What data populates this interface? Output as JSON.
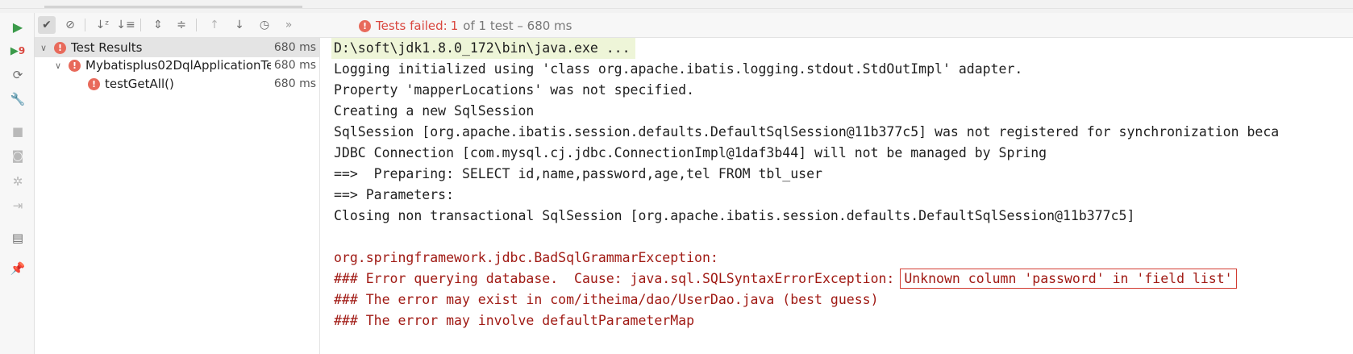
{
  "status": {
    "label": "Tests failed:",
    "failed_count": "1",
    "rest": "of 1 test – 680 ms"
  },
  "tree": {
    "root": {
      "label": "Test Results",
      "time": "680 ms"
    },
    "class_node": {
      "label": "Mybatisplus02DqlApplicationTe",
      "time": "680 ms"
    },
    "method_node": {
      "label": "testGetAll()",
      "time": "680 ms"
    }
  },
  "console": {
    "lines": [
      "D:\\soft\\jdk1.8.0_172\\bin\\java.exe ...",
      "Logging initialized using 'class org.apache.ibatis.logging.stdout.StdOutImpl' adapter.",
      "Property 'mapperLocations' was not specified.",
      "Creating a new SqlSession",
      "SqlSession [org.apache.ibatis.session.defaults.DefaultSqlSession@11b377c5] was not registered for synchronization beca",
      "JDBC Connection [com.mysql.cj.jdbc.ConnectionImpl@1daf3b44] will not be managed by Spring",
      "==>  Preparing: SELECT id,name,password,age,tel FROM tbl_user",
      "==> Parameters: ",
      "Closing non transactional SqlSession [org.apache.ibatis.session.defaults.DefaultSqlSession@11b377c5]",
      "org.springframework.jdbc.BadSqlGrammarException: ",
      "### Error querying database.  Cause: java.sql.SQLSyntaxErrorException: ",
      "Unknown column 'password' in 'field list'",
      "### The error may exist in com/itheima/dao/UserDao.java (best guess)",
      "### The error may involve defaultParameterMap"
    ]
  },
  "colors": {
    "error_red": "#d9473f",
    "console_error": "#a01a14",
    "run_green": "#3b9a4a",
    "highlight_box": "#d23c32"
  },
  "icons": {
    "run": "play-icon",
    "rerun_failed": "rerun-failed-icon",
    "show_passed": "check-icon",
    "show_ignored": "ignored-icon",
    "sort_alpha": "sort-alpha-icon",
    "sort_duration": "sort-duration-icon",
    "expand_all": "expand-all-icon",
    "collapse_all": "collapse-all-icon",
    "prev_failed": "arrow-up-icon",
    "next_failed": "arrow-down-icon",
    "history": "history-icon",
    "more": "more-icon"
  }
}
